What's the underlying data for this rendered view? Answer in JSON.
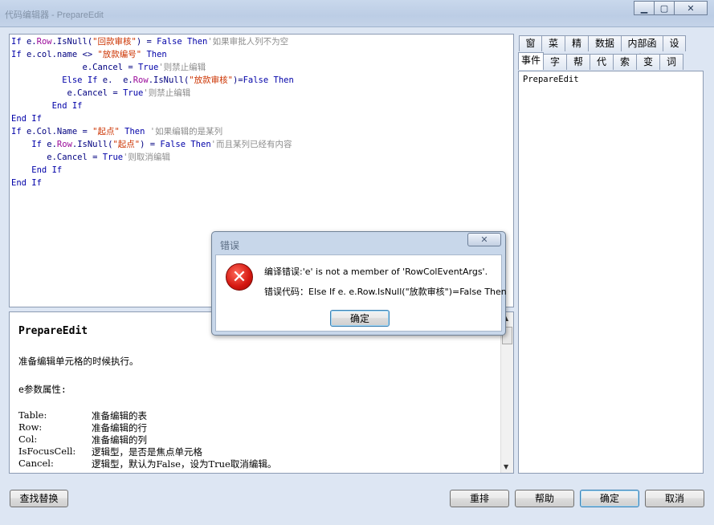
{
  "window": {
    "title": "代码编辑器 - PrepareEdit"
  },
  "code": {
    "lines": [
      [
        {
          "t": "If ",
          "c": "kw"
        },
        {
          "t": "e.",
          "c": "id"
        },
        {
          "t": "Row",
          "c": "pink"
        },
        {
          "t": ".IsNull(",
          "c": "id"
        },
        {
          "t": "\"回款审核\"",
          "c": "str"
        },
        {
          "t": ") = ",
          "c": "id"
        },
        {
          "t": "False Then",
          "c": "kw"
        },
        {
          "t": "'如果审批人列不为空",
          "c": "cm"
        }
      ],
      [
        {
          "t": "If ",
          "c": "kw"
        },
        {
          "t": "e.col.name <> ",
          "c": "id"
        },
        {
          "t": "\"放款编号\"",
          "c": "str"
        },
        {
          "t": " Then",
          "c": "kw"
        }
      ],
      [
        {
          "t": "              e.Cancel = ",
          "c": "id"
        },
        {
          "t": "True",
          "c": "kw"
        },
        {
          "t": "'则禁止编辑",
          "c": "cm"
        }
      ],
      [
        {
          "t": "          ",
          "c": "id"
        },
        {
          "t": "Else If ",
          "c": "kw"
        },
        {
          "t": "e.  e.",
          "c": "id"
        },
        {
          "t": "Row",
          "c": "pink"
        },
        {
          "t": ".IsNull(",
          "c": "id"
        },
        {
          "t": "\"放款审核\"",
          "c": "str"
        },
        {
          "t": ")=",
          "c": "id"
        },
        {
          "t": "False Then",
          "c": "kw"
        }
      ],
      [
        {
          "t": "           e.Cancel = ",
          "c": "id"
        },
        {
          "t": "True",
          "c": "kw"
        },
        {
          "t": "'则禁止编辑",
          "c": "cm"
        }
      ],
      [
        {
          "t": "        End If",
          "c": "kw"
        }
      ],
      [
        {
          "t": "End If",
          "c": "kw"
        }
      ],
      [
        {
          "t": "If ",
          "c": "kw"
        },
        {
          "t": "e.Col.Name = ",
          "c": "id"
        },
        {
          "t": "\"起点\"",
          "c": "str"
        },
        {
          "t": " Then",
          "c": "kw"
        },
        {
          "t": " '如果编辑的是某列",
          "c": "cm"
        }
      ],
      [
        {
          "t": "    If ",
          "c": "kw"
        },
        {
          "t": "e.",
          "c": "id"
        },
        {
          "t": "Row",
          "c": "pink"
        },
        {
          "t": ".IsNull(",
          "c": "id"
        },
        {
          "t": "\"起点\"",
          "c": "str"
        },
        {
          "t": ") = ",
          "c": "id"
        },
        {
          "t": "False Then",
          "c": "kw"
        },
        {
          "t": "'而且某列已经有内容",
          "c": "cm"
        }
      ],
      [
        {
          "t": "       e.Cancel = ",
          "c": "id"
        },
        {
          "t": "True",
          "c": "kw"
        },
        {
          "t": "'则取消编辑",
          "c": "cm"
        }
      ],
      [
        {
          "t": "    End If",
          "c": "kw"
        }
      ],
      [
        {
          "t": "End If",
          "c": "kw"
        }
      ]
    ]
  },
  "help": {
    "title": "PrepareEdit",
    "summary": "准备编辑单元格的时候执行。",
    "params_heading": "e参数属性:",
    "props": [
      {
        "name": "Table:",
        "desc": "准备编辑的表"
      },
      {
        "name": "Row:",
        "desc": "准备编辑的行"
      },
      {
        "name": "Col:",
        "desc": "准备编辑的列"
      },
      {
        "name": "IsFocusCell:",
        "desc": "逻辑型，是否是焦点单元格"
      },
      {
        "name": "Cancel:",
        "desc": "逻辑型，默认为False，设为True取消编辑。"
      }
    ]
  },
  "right_panel": {
    "tabs_row1": [
      "窗口",
      "菜单",
      "精灵",
      "数据源",
      "内部函数",
      "设置"
    ],
    "tabs_row2": [
      "事件",
      "字段",
      "帮助",
      "代码",
      "索引",
      "变量",
      "词汇"
    ],
    "active_tab": "事件",
    "list_items": [
      "PrepareEdit"
    ]
  },
  "buttons": {
    "find_replace": "查找替换",
    "rearrange": "重排",
    "help": "帮助",
    "ok": "确定",
    "cancel": "取消"
  },
  "error_dialog": {
    "title": "错误",
    "message": "编译错误:'e' is not a member of 'RowColEventArgs'.",
    "error_code_label": "错误代码：",
    "error_code": "Else If e. e.Row.IsNull(\"放款审核\")=False Then",
    "ok_label": "确定",
    "icon": "error-x-icon",
    "close_icon": "close-icon"
  },
  "colors": {
    "keyword": "#0000a8",
    "string": "#cc3300",
    "comment": "#8c8c8c",
    "property": "#9a0a9a",
    "error_icon": "#d3160f"
  }
}
